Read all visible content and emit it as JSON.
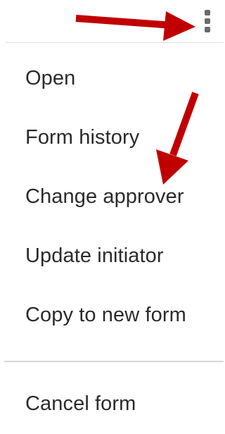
{
  "header": {
    "more_icon": "kebab-vertical-icon"
  },
  "menu": {
    "items": [
      {
        "label": "Open"
      },
      {
        "label": "Form history"
      },
      {
        "label": "Change approver"
      },
      {
        "label": "Update initiator"
      },
      {
        "label": "Copy to new form"
      }
    ],
    "danger_items": [
      {
        "label": "Cancel form"
      }
    ]
  },
  "annotations": {
    "arrow_color": "#c00000"
  }
}
